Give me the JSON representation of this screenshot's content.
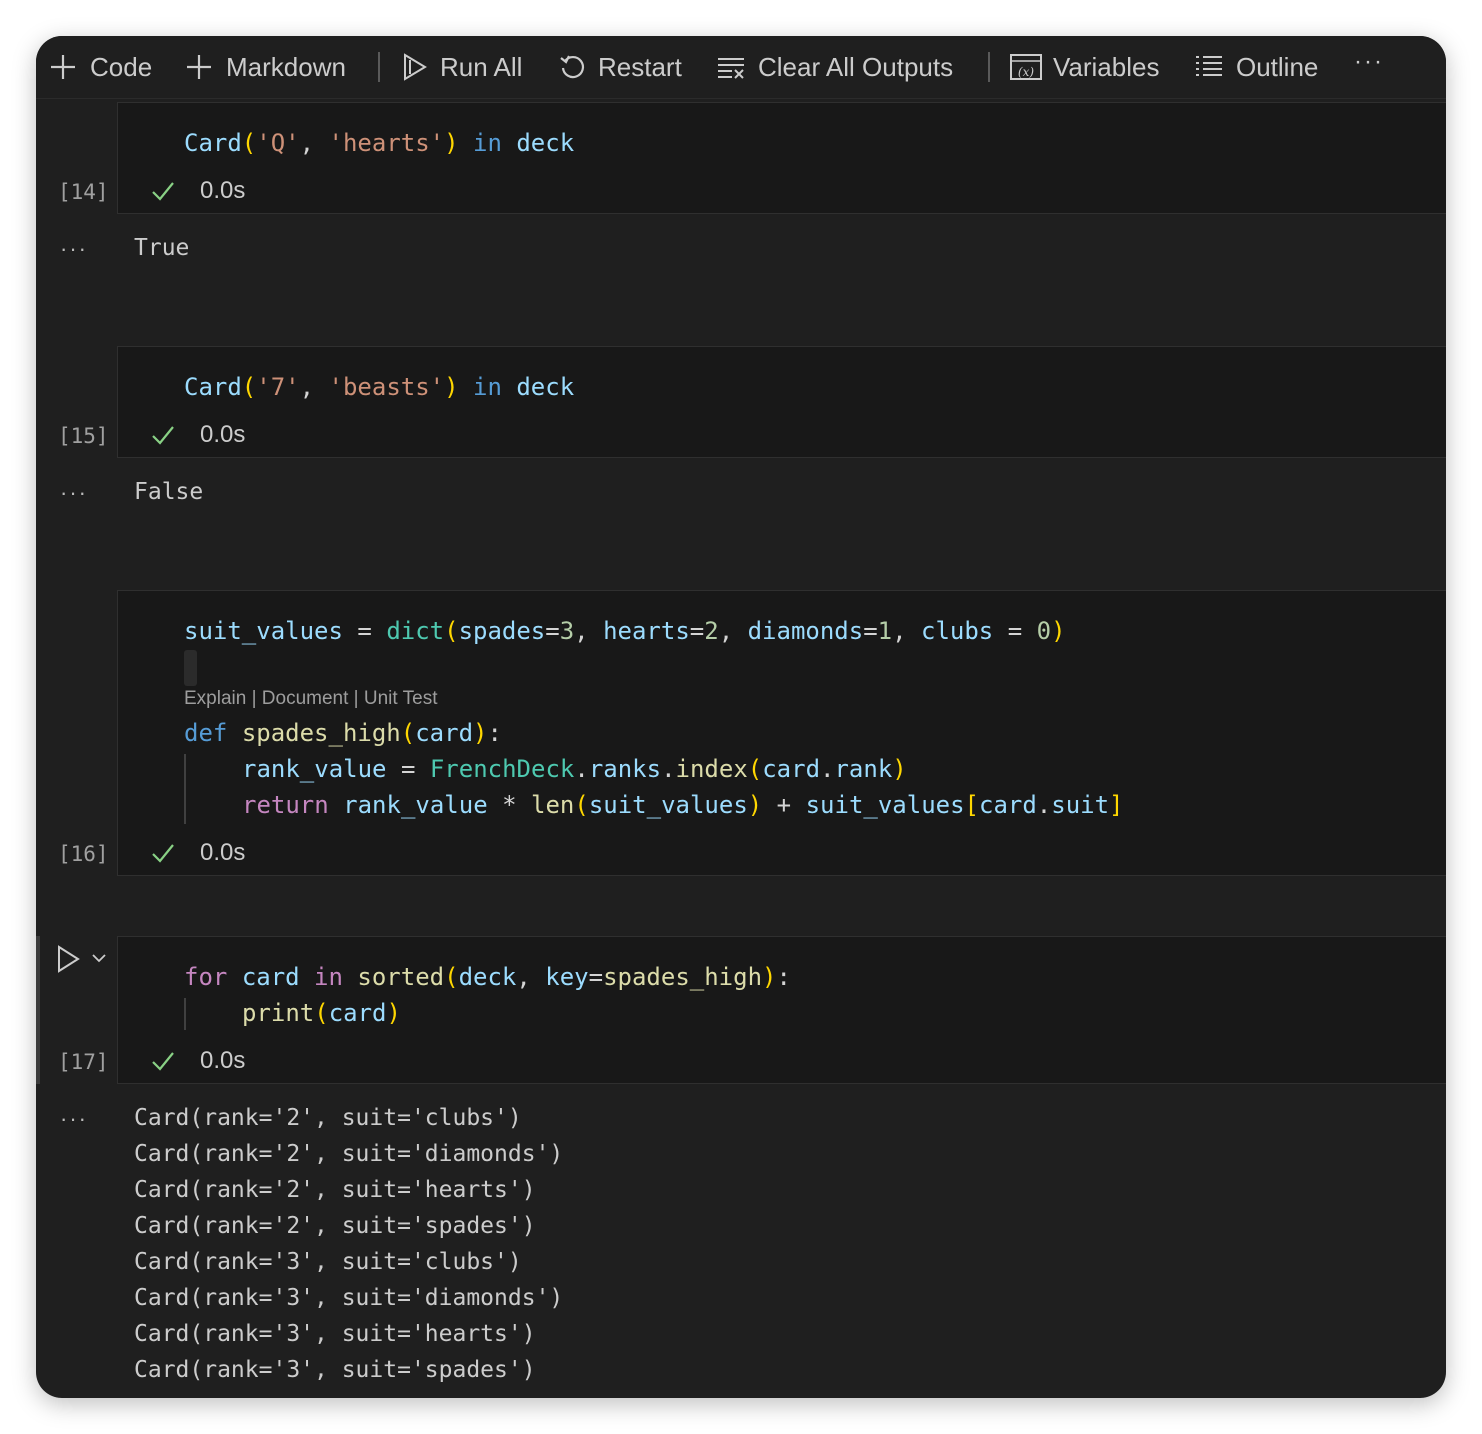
{
  "toolbar": {
    "code_label": "Code",
    "markdown_label": "Markdown",
    "run_all_label": "Run All",
    "restart_label": "Restart",
    "clear_outputs_label": "Clear All Outputs",
    "variables_label": "Variables",
    "outline_label": "Outline",
    "more_label": "···"
  },
  "cells": {
    "c14": {
      "count": "[14]",
      "time": "0.0s",
      "output": "True",
      "code": {
        "t1": "Card",
        "t2": "(",
        "t3": "'Q'",
        "t4": ", ",
        "t5": "'hearts'",
        "t6": ")",
        "t7": " in ",
        "t8": "deck"
      }
    },
    "c15": {
      "count": "[15]",
      "time": "0.0s",
      "output": "False",
      "code": {
        "t1": "Card",
        "t2": "(",
        "t3": "'7'",
        "t4": ", ",
        "t5": "'beasts'",
        "t6": ")",
        "t7": " in ",
        "t8": "deck"
      }
    },
    "c16": {
      "count": "[16]",
      "time": "0.0s",
      "codelens": "Explain | Document | Unit Test",
      "line1": {
        "a": "suit_values",
        "b": " = ",
        "c": "dict",
        "d": "(",
        "e": "spades",
        "f": "=",
        "g": "3",
        "h": ", ",
        "i": "hearts",
        "j": "=",
        "k": "2",
        "l": ", ",
        "m": "diamonds",
        "n": "=",
        "o": "1",
        "p": ", ",
        "q": "clubs",
        "r": " = ",
        "s": "0",
        "t": ")"
      },
      "line2": {
        "a": "def",
        "b": " ",
        "c": "spades_high",
        "d": "(",
        "e": "card",
        "f": ")",
        "g": ":"
      },
      "line3": {
        "a": "rank_value",
        "b": " = ",
        "c": "FrenchDeck",
        "d": ".",
        "e": "ranks",
        "f": ".",
        "g": "index",
        "h": "(",
        "i": "card",
        "j": ".",
        "k": "rank",
        "l": ")"
      },
      "line4": {
        "a": "return",
        "b": " ",
        "c": "rank_value",
        "d": " * ",
        "e": "len",
        "f": "(",
        "g": "suit_values",
        "h": ")",
        "i": " + ",
        "j": "suit_values",
        "k": "[",
        "l": "card",
        "m": ".",
        "n": "suit",
        "o": "]"
      }
    },
    "c17": {
      "count": "[17]",
      "time": "0.0s",
      "line1": {
        "a": "for",
        "b": " ",
        "c": "card",
        "d": " in ",
        "e": "sorted",
        "f": "(",
        "g": "deck",
        "h": ", ",
        "i": "key",
        "j": "=",
        "k": "spades_high",
        "l": ")",
        "m": ":"
      },
      "line2": {
        "a": "print",
        "b": "(",
        "c": "card",
        "d": ")"
      },
      "outputs": [
        "Card(rank='2', suit='clubs')",
        "Card(rank='2', suit='diamonds')",
        "Card(rank='2', suit='hearts')",
        "Card(rank='2', suit='spades')",
        "Card(rank='3', suit='clubs')",
        "Card(rank='3', suit='diamonds')",
        "Card(rank='3', suit='hearts')",
        "Card(rank='3', suit='spades')"
      ]
    }
  },
  "output_ellipsis": "···",
  "colors": {
    "background": "#1f1f1f",
    "cell_background": "#181818",
    "success_check": "#89d185",
    "keyword": "#569cd6",
    "control": "#c586c0",
    "function": "#dcdcaa",
    "variable": "#9cdcfe",
    "string": "#ce9178",
    "number": "#b5cea8"
  }
}
